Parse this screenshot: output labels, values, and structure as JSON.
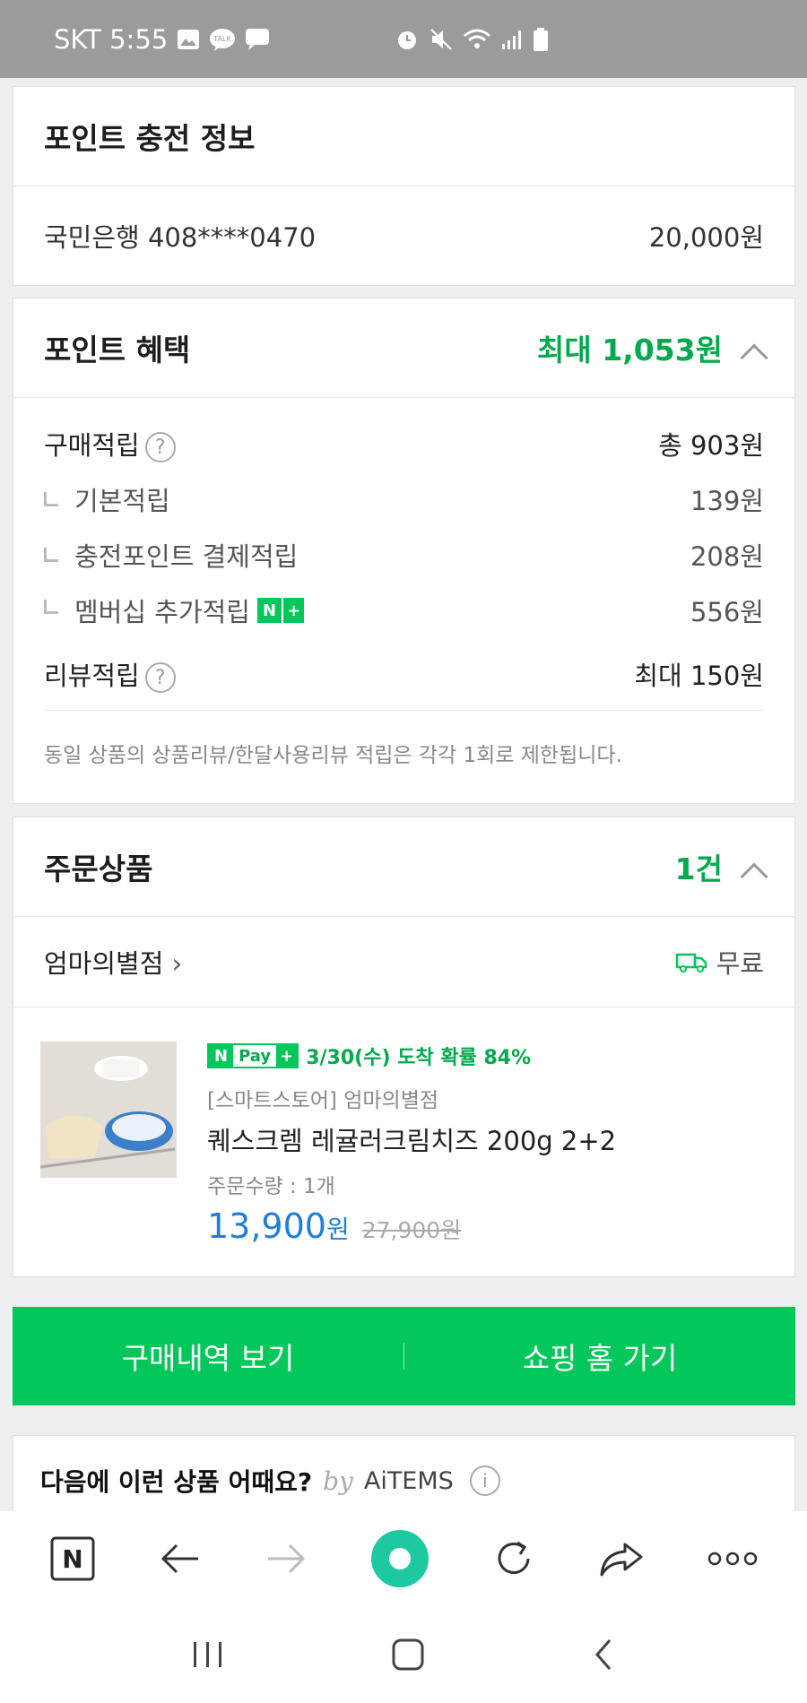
{
  "status_bar": {
    "carrier_time": "SKT 5:55"
  },
  "charge_info": {
    "title": "포인트 충전 정보",
    "account": "국민은행 408****0470",
    "amount": "20,000원"
  },
  "benefits": {
    "title": "포인트 혜택",
    "max": "최대 1,053원",
    "purchase_label": "구매적립",
    "purchase_total": "총 903원",
    "sub_items": [
      {
        "label": "기본적립",
        "value": "139원"
      },
      {
        "label": "충전포인트 결제적립",
        "value": "208원"
      },
      {
        "label": "멤버십 추가적립",
        "value": "556원"
      }
    ],
    "review_label": "리뷰적립",
    "review_value": "최대 150원",
    "notice": "동일 상품의 상품리뷰/한달사용리뷰 적립은 각각 1회로 제한됩니다."
  },
  "order": {
    "title": "주문상품",
    "count": "1건",
    "store": "엄마의별점",
    "shipping": "무료",
    "badge_n": "N",
    "badge_pay": "Pay",
    "badge_plus": "+",
    "arrival": "3/30(수) 도착 확률 84%",
    "seller": "[스마트스토어] 엄마의별점",
    "product_name": "퀘스크렘 레귤러크림치즈 200g 2+2",
    "quantity": "주문수량 : 1개",
    "price": "13,900",
    "price_unit": "원",
    "original_price": "27,900원"
  },
  "buttons": {
    "history": "구매내역 보기",
    "shop_home": "쇼핑 홈 가기"
  },
  "recommend": {
    "title": "다음에 이런 상품 어때요?",
    "by": "by",
    "brand": "AiTEMS"
  },
  "membership_badge": {
    "n": "N",
    "plus": "+"
  },
  "colors": {
    "accent": "#03c75a",
    "accent_text": "#03a94d",
    "price_blue": "#1f7fd6"
  }
}
